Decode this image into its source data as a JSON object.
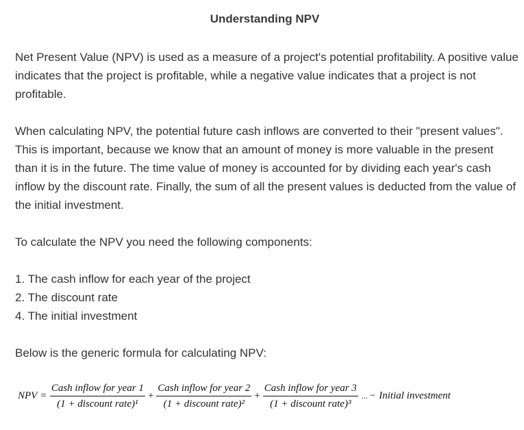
{
  "title": "Understanding NPV",
  "paragraphs": {
    "intro": "Net Present Value (NPV) is used as a measure of a project's potential profitability. A positive value indicates that the project is profitable, while a negative value indicates that a project is not profitable.",
    "calculation": "When calculating NPV, the potential future cash inflows are converted to their \"present values\". This is important, because we know that an amount of money is more valuable in the present than it is in the future. The time value of money is accounted for by dividing each year's cash inflow by the discount rate. Finally, the sum of all the present values is deducted from the value of the initial investment.",
    "components_intro": "To calculate the NPV you need the following components:",
    "formula_intro": "Below is the generic formula for calculating NPV:"
  },
  "components": [
    "1. The cash inflow for each year of the project",
    "2. The discount rate",
    "4. The initial investment"
  ],
  "formula": {
    "lhs": "NPV",
    "equals": "=",
    "terms": [
      {
        "numerator": "Cash inflow for year 1",
        "denominator": "(1 + discount rate)¹"
      },
      {
        "numerator": "Cash inflow for year 2",
        "denominator": "(1 + discount rate)²"
      },
      {
        "numerator": "Cash inflow for year 3",
        "denominator": "(1 + discount rate)³"
      }
    ],
    "plus": "+",
    "ellipsis": "...",
    "minus": "−",
    "tail": "Initial investment"
  }
}
